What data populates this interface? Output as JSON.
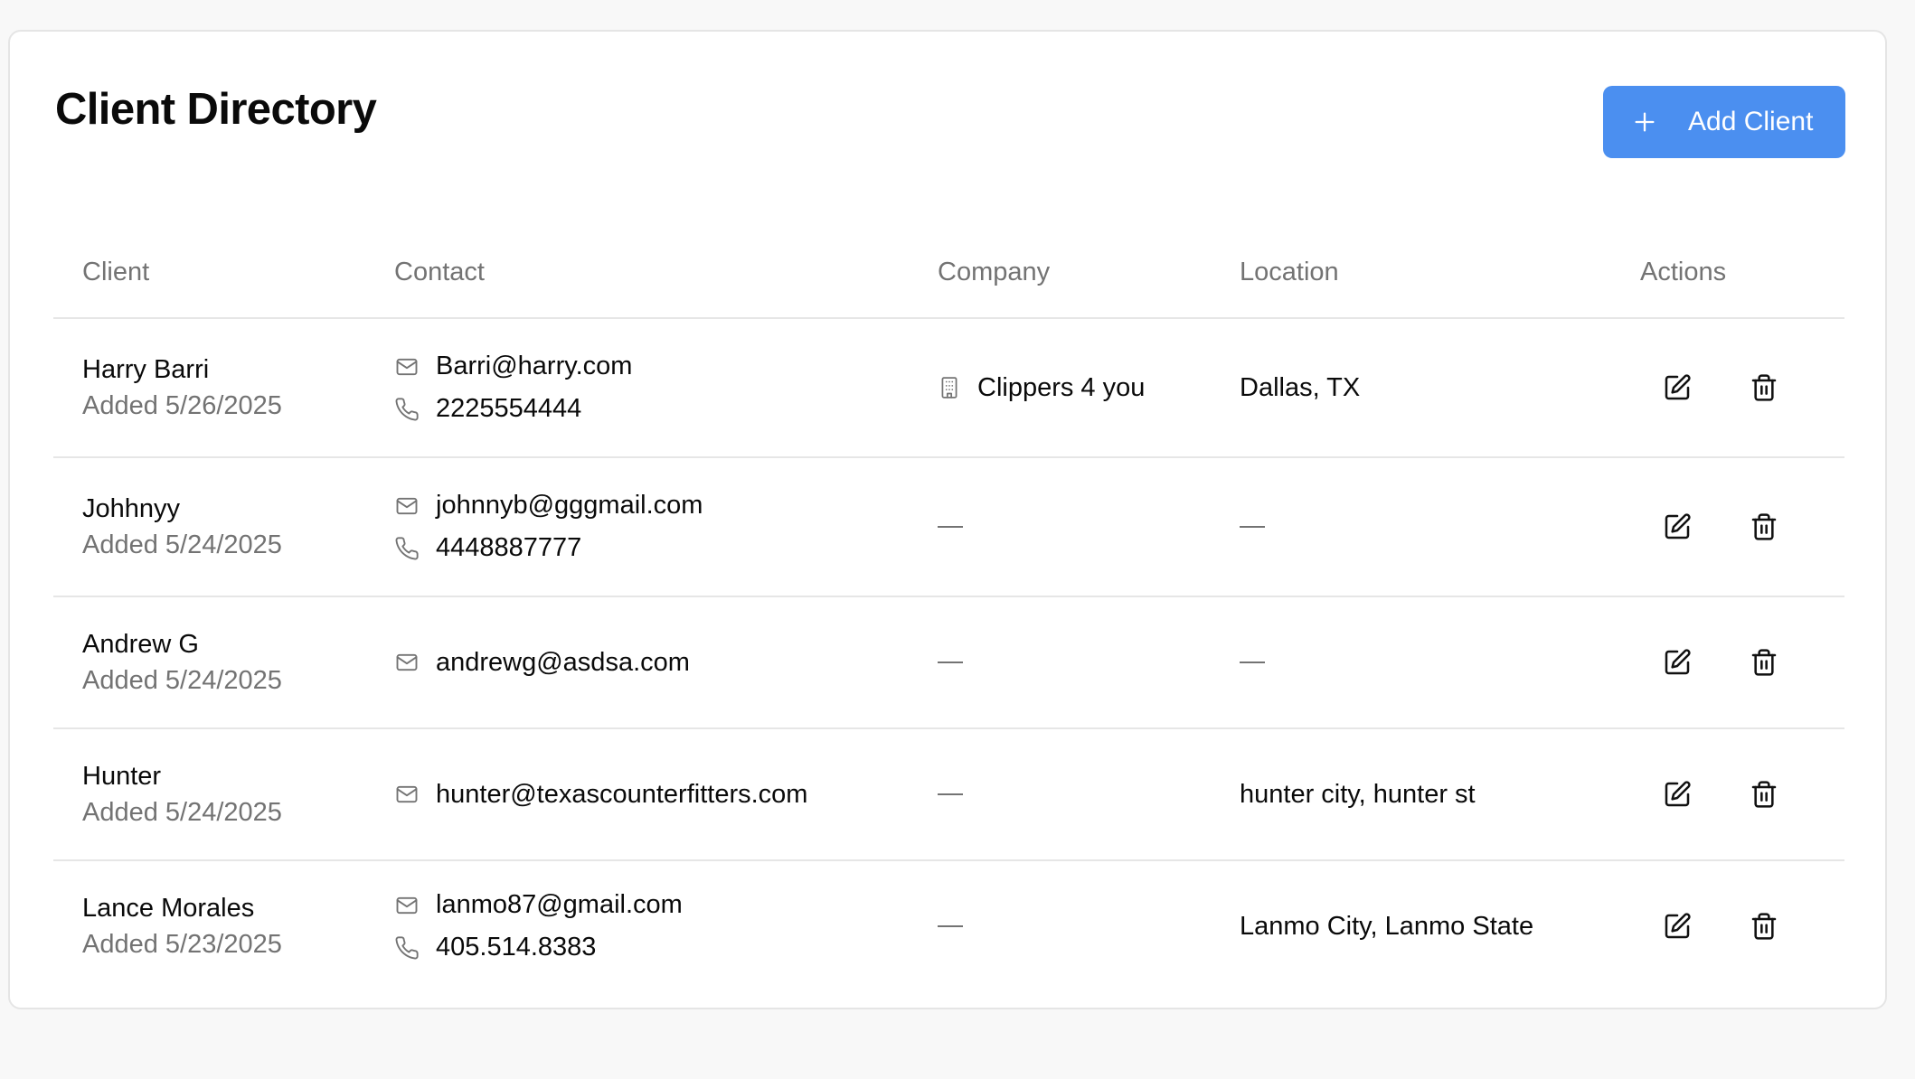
{
  "header": {
    "title": "Client Directory",
    "add_button_label": "Add Client",
    "add_button_icon": "plus-icon"
  },
  "colors": {
    "accent": "#4b8ff0",
    "muted_text": "#737373",
    "border": "#e6e6e6",
    "page_background": "#f8f8f8",
    "card_background": "#ffffff"
  },
  "table": {
    "columns": [
      "Client",
      "Contact",
      "Company",
      "Location",
      "Actions"
    ],
    "empty_placeholder": "—",
    "rows": [
      {
        "name": "Harry Barri",
        "added": "Added 5/26/2025",
        "email": "Barri@harry.com",
        "phone": "2225554444",
        "company": "Clippers 4 you",
        "location": "Dallas, TX"
      },
      {
        "name": "Johhnyy",
        "added": "Added 5/24/2025",
        "email": "johnnyb@gggmail.com",
        "phone": "4448887777",
        "company": "",
        "location": ""
      },
      {
        "name": "Andrew G",
        "added": "Added 5/24/2025",
        "email": "andrewg@asdsa.com",
        "phone": "",
        "company": "",
        "location": ""
      },
      {
        "name": "Hunter",
        "added": "Added 5/24/2025",
        "email": "hunter@texascounterfitters.com",
        "phone": "",
        "company": "",
        "location": "hunter city, hunter st"
      },
      {
        "name": "Lance Morales",
        "added": "Added 5/23/2025",
        "email": "lanmo87@gmail.com",
        "phone": "405.514.8383",
        "company": "",
        "location": "Lanmo City, Lanmo State"
      }
    ],
    "icons": {
      "email": "mail-icon",
      "phone": "phone-icon",
      "company": "building-icon",
      "edit": "edit-icon",
      "delete": "trash-icon"
    }
  }
}
